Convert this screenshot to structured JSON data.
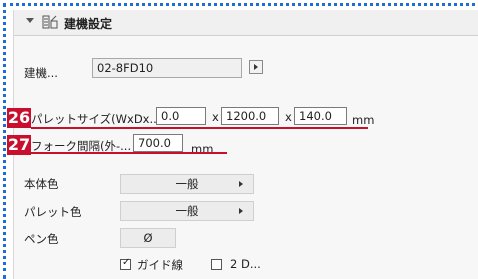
{
  "header": {
    "title": "建機設定"
  },
  "building": {
    "label": "建機...",
    "value": "02-8FD10"
  },
  "pallet_size": {
    "callout": "26",
    "label": "パレットサイズ(WxDx...",
    "w": "0.0",
    "d": "1200.0",
    "h": "140.0",
    "sep1": "x",
    "sep2": "x",
    "unit": "mm"
  },
  "fork_spacing": {
    "callout": "27",
    "label": "フォーク間隔(外-...",
    "value": "700.0",
    "unit": "mm"
  },
  "body_color": {
    "label": "本体色",
    "value": "一般"
  },
  "pallet_color": {
    "label": "パレット色",
    "value": "一般"
  },
  "pen_color": {
    "label": "ペン色",
    "value": "Ø"
  },
  "guide_line": {
    "label": "ガイド線",
    "checked": true
  },
  "two_d": {
    "label": "2 D...",
    "checked": false
  },
  "colors": {
    "callout": "#c8102e",
    "dotted_border": "#1c6fd1"
  }
}
